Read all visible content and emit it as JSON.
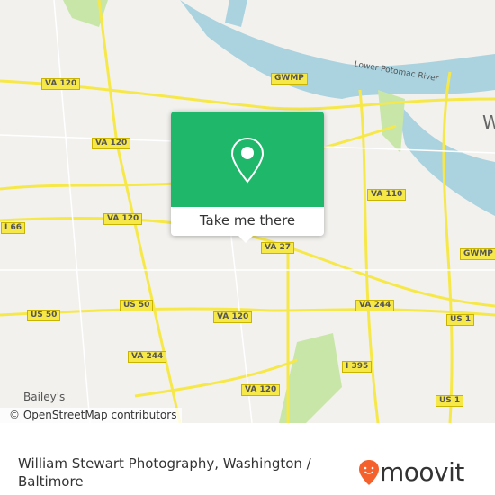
{
  "map": {
    "attribution": "© OpenStreetMap contributors",
    "place_labels": [
      "Bailey's",
      "W",
      "Lower Potomac River"
    ],
    "road_shields": [
      {
        "label": "VA 120",
        "id": "a"
      },
      {
        "label": "VA 120",
        "id": "b"
      },
      {
        "label": "VA 120",
        "id": "c"
      },
      {
        "label": "VA 120",
        "id": "d"
      },
      {
        "label": "VA 120",
        "id": "e"
      },
      {
        "label": "GWMP",
        "id": "f"
      },
      {
        "label": "GWMP",
        "id": "g"
      },
      {
        "label": "VA 110",
        "id": "h"
      },
      {
        "label": "VA 27",
        "id": "i"
      },
      {
        "label": "I 66",
        "id": "j"
      },
      {
        "label": "US 50",
        "id": "k"
      },
      {
        "label": "US 50",
        "id": "l"
      },
      {
        "label": "VA 244",
        "id": "m"
      },
      {
        "label": "VA 244",
        "id": "n"
      },
      {
        "label": "I 395",
        "id": "o"
      },
      {
        "label": "US 1",
        "id": "p"
      },
      {
        "label": "US 1",
        "id": "q"
      }
    ],
    "colors": {
      "water": "#aad3df",
      "park": "#c8e6a8",
      "road": "#f7e84a",
      "land": "#f2f1ee"
    }
  },
  "popup": {
    "button_label": "Take me there",
    "icon": "map-pin-icon",
    "color": "#1fb86b"
  },
  "footer": {
    "title": "William Stewart Photography, Washington / Baltimore",
    "logo_text": "moovit",
    "logo_color": "#f4612c"
  }
}
